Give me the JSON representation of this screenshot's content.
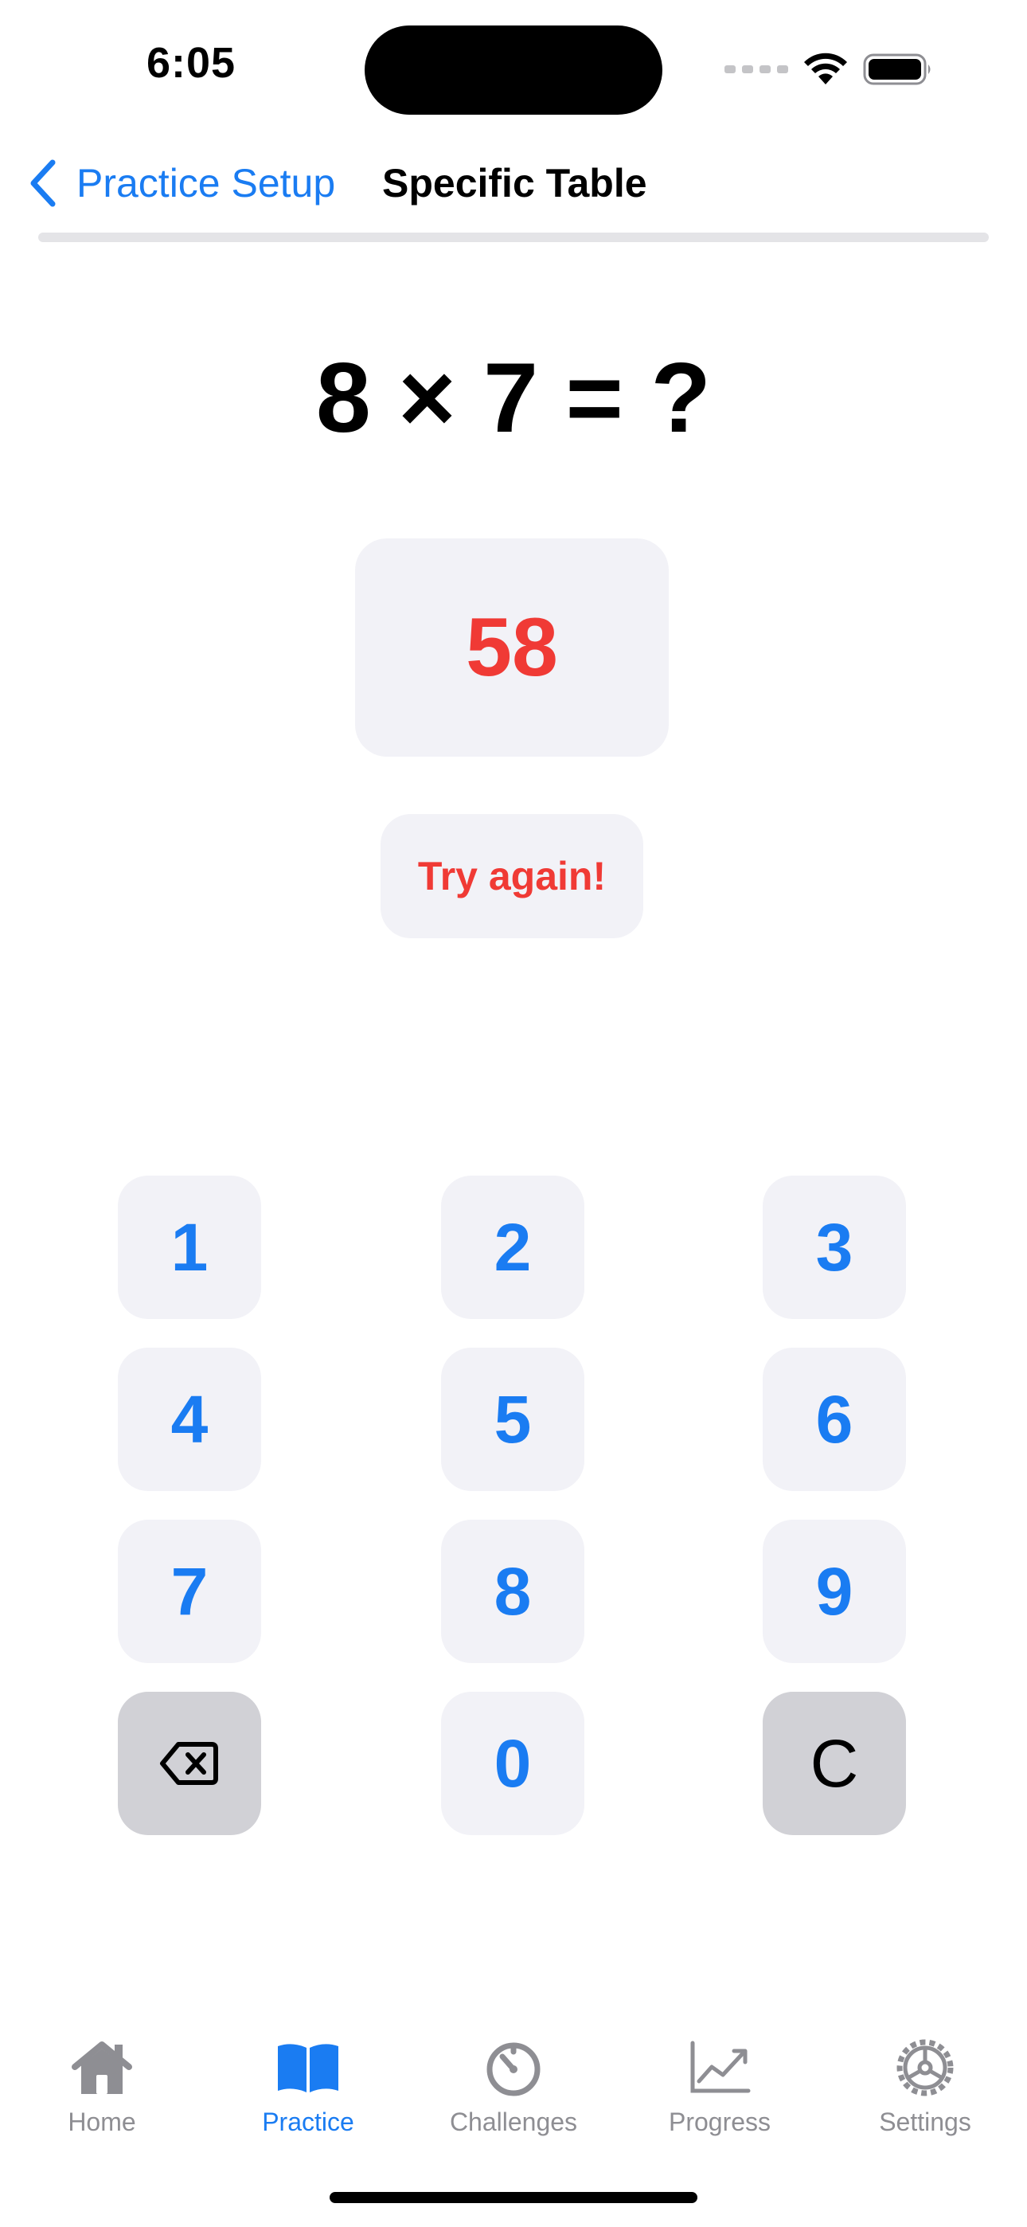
{
  "status_bar": {
    "time": "6:05"
  },
  "nav": {
    "back_label": "Practice Setup",
    "title": "Specific Table"
  },
  "practice": {
    "question": "8 × 7 = ?",
    "answer": "58",
    "feedback": "Try again!"
  },
  "keypad": {
    "keys": [
      "1",
      "2",
      "3",
      "4",
      "5",
      "6",
      "7",
      "8",
      "9",
      "0",
      "C"
    ],
    "delete_icon": "delete-backward-icon"
  },
  "tab_bar": {
    "tabs": [
      {
        "label": "Home",
        "icon": "house-icon"
      },
      {
        "label": "Practice",
        "icon": "book-icon"
      },
      {
        "label": "Challenges",
        "icon": "timer-icon"
      },
      {
        "label": "Progress",
        "icon": "chart-icon"
      },
      {
        "label": "Settings",
        "icon": "gear-icon"
      }
    ],
    "active": "Practice"
  },
  "colors": {
    "accent": "#1a7cf2",
    "error": "#f03a35",
    "key_background": "#f2f2f7",
    "key_gray": "#d1d1d6",
    "inactive": "#8e8e93"
  }
}
